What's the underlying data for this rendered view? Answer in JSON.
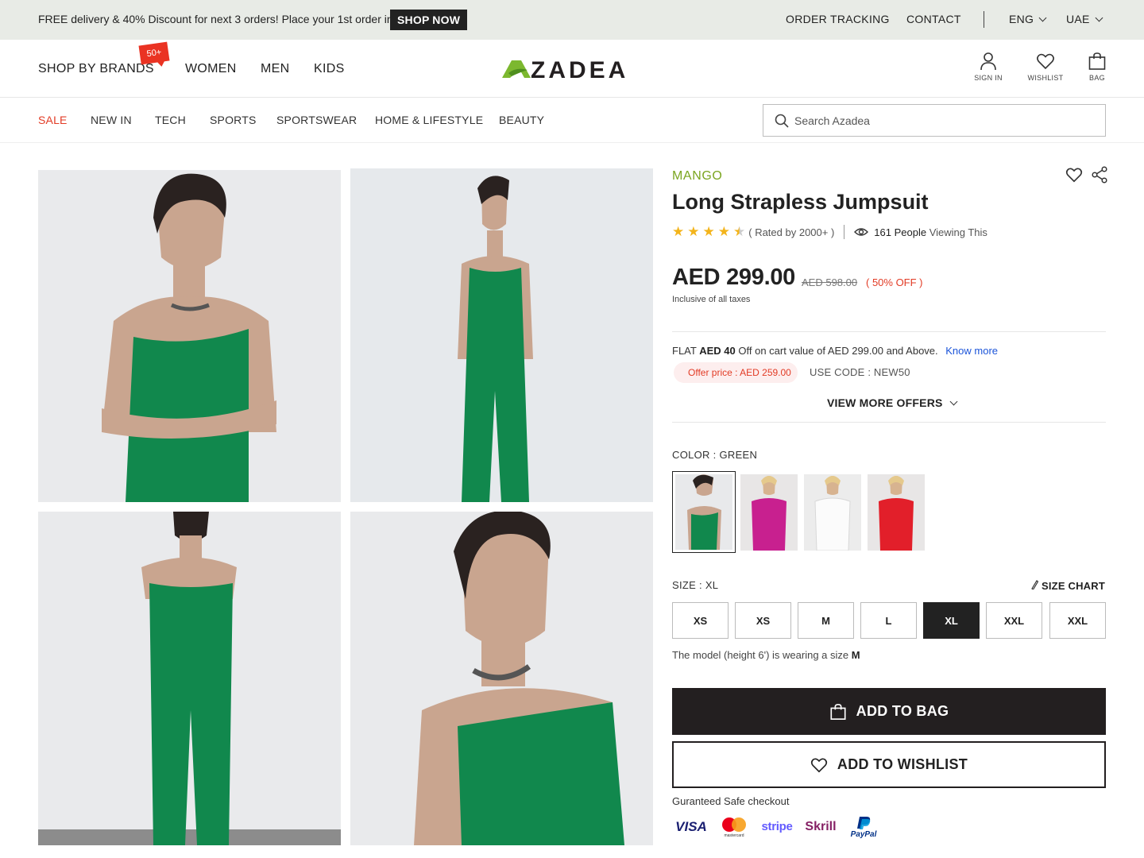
{
  "promo": {
    "text": "FREE delivery & 40% Discount for next 3 orders! Place your 1st order in.",
    "cta": "SHOP NOW"
  },
  "top_links": {
    "order_tracking": "ORDER TRACKING",
    "contact": "CONTACT",
    "language": "ENG",
    "country": "UAE"
  },
  "header": {
    "nav": {
      "brands": "SHOP BY BRANDS",
      "brands_badge": "50+",
      "women": "WOMEN",
      "men": "MEN",
      "kids": "KIDS"
    },
    "logo_text": "ZADEA",
    "icons": {
      "sign_in": "SIGN IN",
      "wishlist": "WISHLIST",
      "bag": "BAG"
    }
  },
  "categories": [
    "SALE",
    "NEW IN",
    "TECH",
    "SPORTS",
    "SPORTSWEAR",
    "HOME & LIFESTYLE",
    "BEAUTY"
  ],
  "search": {
    "placeholder": "Search Azadea"
  },
  "product": {
    "brand": "MANGO",
    "title": "Long Strapless Jumpsuit",
    "rating": 4.5,
    "rating_text": "( Rated by 2000+ )",
    "viewers_count": "161 People",
    "viewers_suffix": "Viewing This",
    "price": "AED 299.00",
    "old_price": "AED 598.00",
    "discount": "( 50% OFF )",
    "tax_note": "Inclusive of all taxes",
    "offer": {
      "prefix": "FLAT",
      "amount": "AED 40",
      "text": "Off on cart value of AED 299.00 and Above.",
      "link": "Know more",
      "pill": "Offer price : AED  259.00",
      "code": "USE CODE : NEW50",
      "view_more": "VIEW MORE OFFERS"
    },
    "color_label": "COLOR : GREEN",
    "colors": [
      "green",
      "magenta",
      "white",
      "red"
    ],
    "size_label": "SIZE : XL",
    "size_chart": "SIZE CHART",
    "sizes": [
      "XS",
      "XS",
      "M",
      "L",
      "XL",
      "XXL",
      "XXL"
    ],
    "selected_size_index": 4,
    "model_note": "The model (height 6') is wearing a size",
    "model_size": "M",
    "add_to_bag": "ADD TO BAG",
    "add_to_wishlist": "ADD TO WISHLIST",
    "safe_checkout": "Guranteed Safe checkout",
    "payments": {
      "visa": "VISA",
      "mastercard": "mastercard",
      "stripe": "stripe",
      "skrill": "Skrill",
      "paypal": "PayPal"
    }
  },
  "colors": {
    "accent_green": "#7aa51f",
    "sale_red": "#e23b25",
    "link_blue": "#1b54d9",
    "star": "#f3b41b",
    "dark": "#231f20",
    "garment_green": "#11884d"
  }
}
